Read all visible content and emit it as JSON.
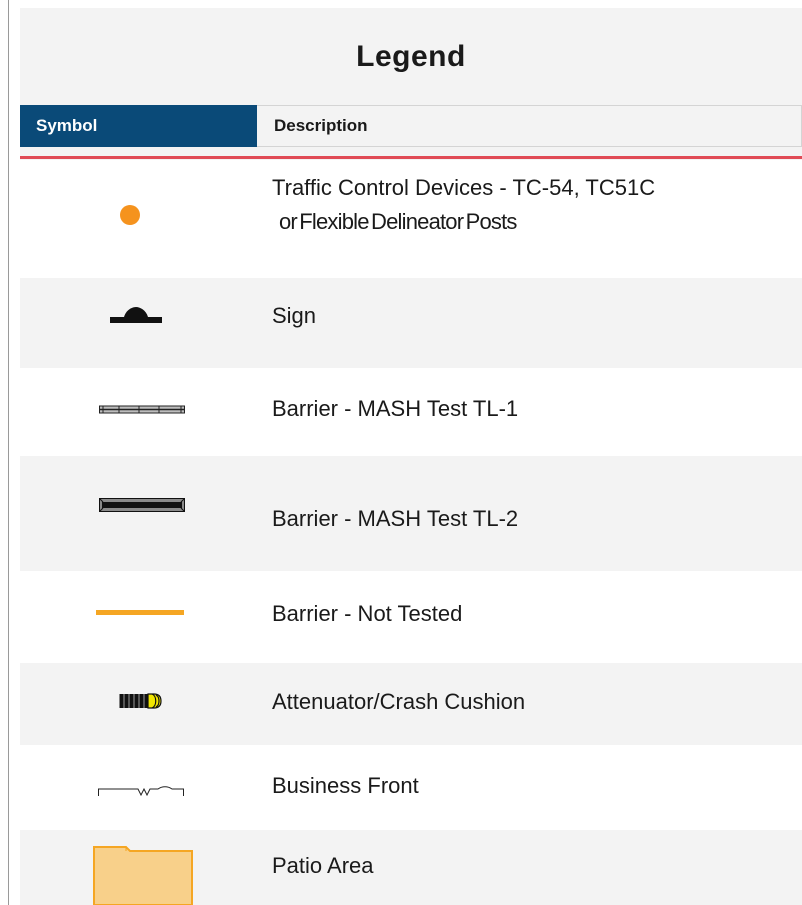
{
  "legend": {
    "title": "Legend",
    "columns": {
      "symbol": "Symbol",
      "description": "Description"
    },
    "rows": [
      {
        "icon": "traffic-control-device-dot-icon",
        "description_line1": "Traffic Control Devices - TC-54, TC51C",
        "description_line2": "or Flexible Delineator Posts"
      },
      {
        "icon": "sign-icon",
        "description": "Sign"
      },
      {
        "icon": "barrier-tl1-icon",
        "description": "Barrier - MASH Test TL-1"
      },
      {
        "icon": "barrier-tl2-icon",
        "description": "Barrier - MASH Test TL-2"
      },
      {
        "icon": "barrier-not-tested-icon",
        "description": "Barrier - Not Tested"
      },
      {
        "icon": "attenuator-icon",
        "description": "Attenuator/Crash Cushion"
      },
      {
        "icon": "business-front-icon",
        "description": "Business Front"
      },
      {
        "icon": "patio-area-icon",
        "description": "Patio Area"
      }
    ]
  },
  "colors": {
    "header_blue": "#0a4a78",
    "accent_red": "#e04a55",
    "device_orange": "#f5931e",
    "barrier_yellow": "#f5a623",
    "patio_fill": "#f8d08a",
    "patio_border": "#f5a623",
    "attenuator_yellow": "#f2e600"
  }
}
